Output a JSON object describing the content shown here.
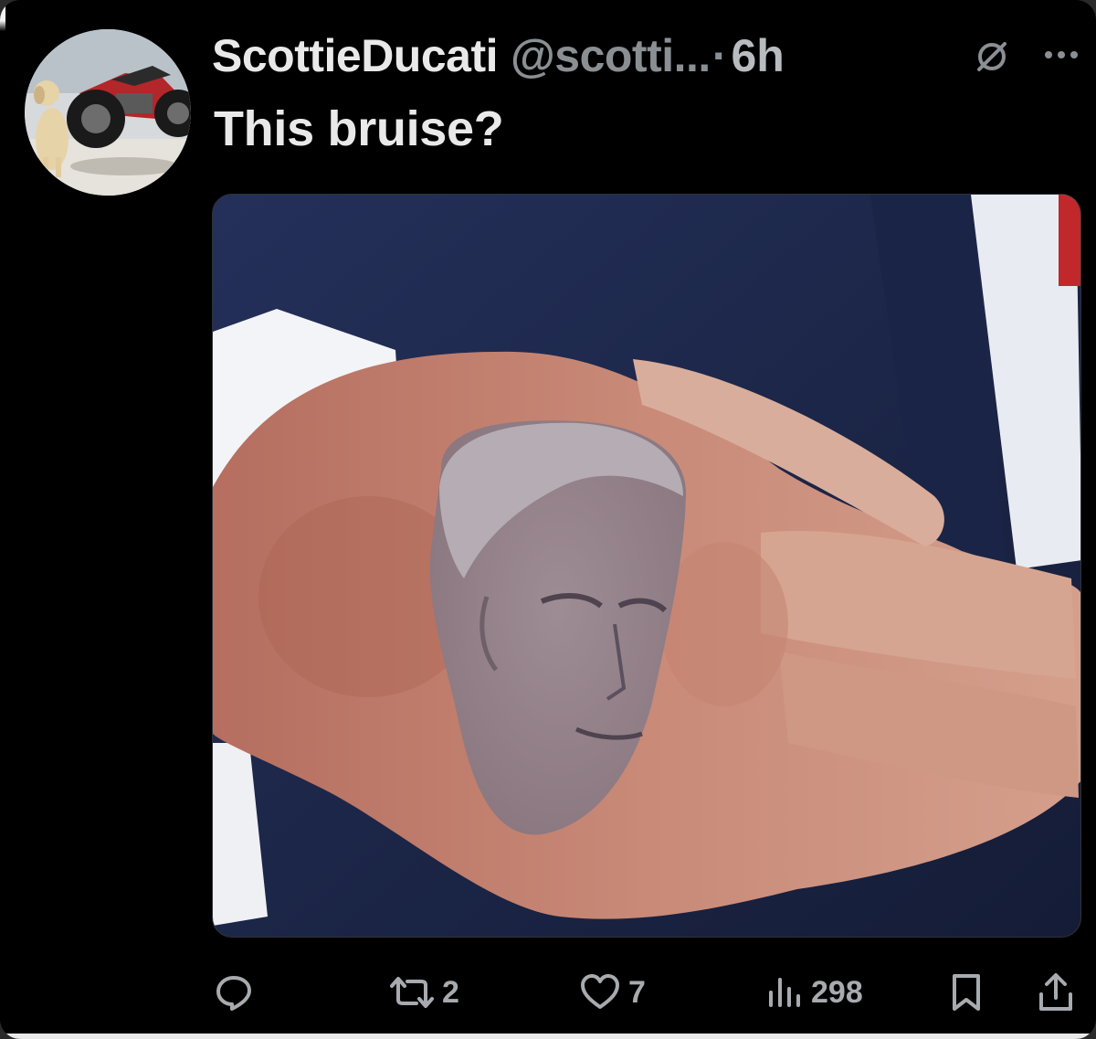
{
  "post": {
    "display_name": "ScottieDucati",
    "handle": "@scotti...",
    "separator": "·",
    "time": "6h",
    "text": "This bruise?"
  },
  "icons": {
    "grok": "grok-icon",
    "more": "more-icon",
    "reply": "reply-icon",
    "repost": "repost-icon",
    "like": "heart-icon",
    "views": "views-icon",
    "bookmark": "bookmark-icon",
    "share": "share-icon"
  },
  "actions": {
    "reply_count": "",
    "repost_count": "2",
    "like_count": "7",
    "view_count": "298"
  },
  "colors": {
    "background": "#000000",
    "text_primary": "#e9e9e9",
    "text_secondary": "#8a8f94",
    "action_gray": "#a7abaf"
  }
}
